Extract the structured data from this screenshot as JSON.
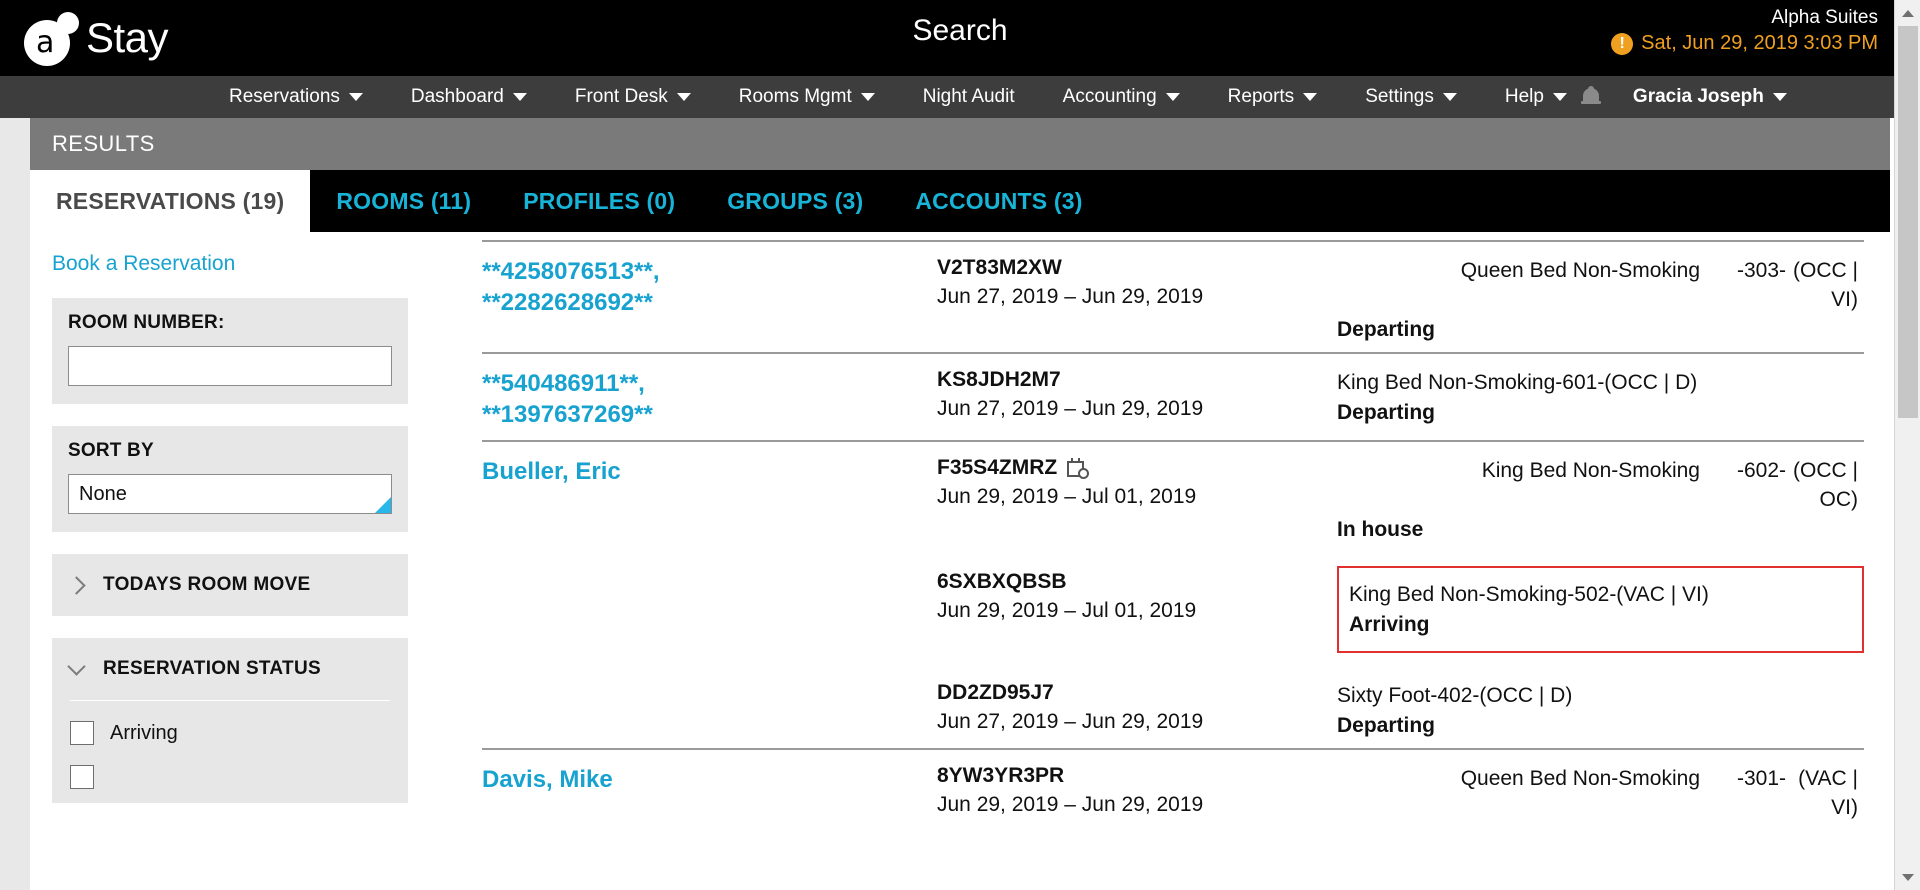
{
  "header": {
    "logo_text": "Stay",
    "logo_icon": "a-circle-logo",
    "page_title": "Search",
    "hotel_name": "Alpha Suites",
    "datetime": "Sat, Jun 29, 2019 3:03 PM",
    "warning_icon": "alert-exclamation-icon",
    "accent_orange": "#f0a020"
  },
  "nav": {
    "items": [
      {
        "label": "Reservations",
        "has_caret": true
      },
      {
        "label": "Dashboard",
        "has_caret": true
      },
      {
        "label": "Front Desk",
        "has_caret": true
      },
      {
        "label": "Rooms Mgmt",
        "has_caret": true
      },
      {
        "label": "Night Audit",
        "has_caret": false
      },
      {
        "label": "Accounting",
        "has_caret": true
      },
      {
        "label": "Reports",
        "has_caret": true
      },
      {
        "label": "Settings",
        "has_caret": true
      },
      {
        "label": "Help",
        "has_caret": true
      }
    ],
    "bell_icon": "notification-bell-icon",
    "user": {
      "label": "Gracia Joseph",
      "has_caret": true
    }
  },
  "results_bar": {
    "label": "RESULTS"
  },
  "tabs": [
    {
      "label": "RESERVATIONS (19)",
      "active": true
    },
    {
      "label": "ROOMS (11)",
      "active": false
    },
    {
      "label": "PROFILES (0)",
      "active": false
    },
    {
      "label": "GROUPS (3)",
      "active": false
    },
    {
      "label": "ACCOUNTS (3)",
      "active": false
    }
  ],
  "sidebar": {
    "book_link": "Book a Reservation",
    "room_number": {
      "label": "ROOM NUMBER:",
      "value": "",
      "placeholder": ""
    },
    "sort_by": {
      "label": "SORT BY",
      "value": "None"
    },
    "todays_room_move": {
      "title": "TODAYS ROOM MOVE",
      "expanded": false
    },
    "reservation_status": {
      "title": "RESERVATION STATUS",
      "expanded": true,
      "options": [
        {
          "label": "Arriving",
          "checked": false
        },
        {
          "label": "",
          "checked": false
        }
      ]
    }
  },
  "results": {
    "rows": [
      {
        "guest": "**4258076513**,\n**2282628692**",
        "guest_line1": "**4258076513**,",
        "guest_line2": "**2282628692**",
        "confirmation": "V2T83M2XW",
        "dates": "Jun 27, 2019 – Jun 29, 2019",
        "has_calendar_icon": false,
        "room_type": "Queen Bed Non-Smoking",
        "room_number": "-303-",
        "room_status_code": "(OCC | VI)",
        "split_cells": true,
        "status": "Departing",
        "highlighted": false
      },
      {
        "guest_line1": "**540486911**,",
        "guest_line2": "**1397637269**",
        "confirmation": "KS8JDH2M7",
        "dates": "Jun 27, 2019 – Jun 29, 2019",
        "has_calendar_icon": false,
        "room_full": "King Bed Non-Smoking-601-(OCC | D)",
        "split_cells": false,
        "status": "Departing",
        "highlighted": false
      },
      {
        "guest_line1": "Bueller, Eric",
        "guest_line2": "",
        "confirmation": "F35S4ZMRZ",
        "dates": "Jun 29, 2019 – Jul 01, 2019",
        "has_calendar_icon": true,
        "room_type": "King Bed Non-Smoking",
        "room_number": "-602-",
        "room_status_code": "(OCC | OC)",
        "split_cells": true,
        "status": "In house",
        "highlighted": false,
        "sub_rows": [
          {
            "confirmation": "6SXBXQBSB",
            "dates": "Jun 29, 2019 – Jul 01, 2019",
            "has_calendar_icon": false,
            "room_full": "King Bed Non-Smoking-502-(VAC | VI)",
            "split_cells": false,
            "status": "Arriving",
            "highlighted": true
          },
          {
            "confirmation": "DD2ZD95J7",
            "dates": "Jun 27, 2019 – Jun 29, 2019",
            "has_calendar_icon": false,
            "room_full": "Sixty Foot-402-(OCC | D)",
            "split_cells": false,
            "status": "Departing",
            "highlighted": false
          }
        ]
      },
      {
        "guest_line1": "Davis, Mike",
        "guest_line2": "",
        "confirmation": "8YW3YR3PR",
        "dates": "Jun 29, 2019 – Jun 29, 2019",
        "has_calendar_icon": false,
        "room_type": "Queen Bed Non-Smoking",
        "room_number": "-301-",
        "room_status_code": "(VAC | VI)",
        "split_cells": true,
        "status": "",
        "highlighted": false
      }
    ]
  },
  "scrollbar": {
    "up_icon": "scroll-up-arrow-icon",
    "down_icon": "scroll-down-arrow-icon"
  }
}
